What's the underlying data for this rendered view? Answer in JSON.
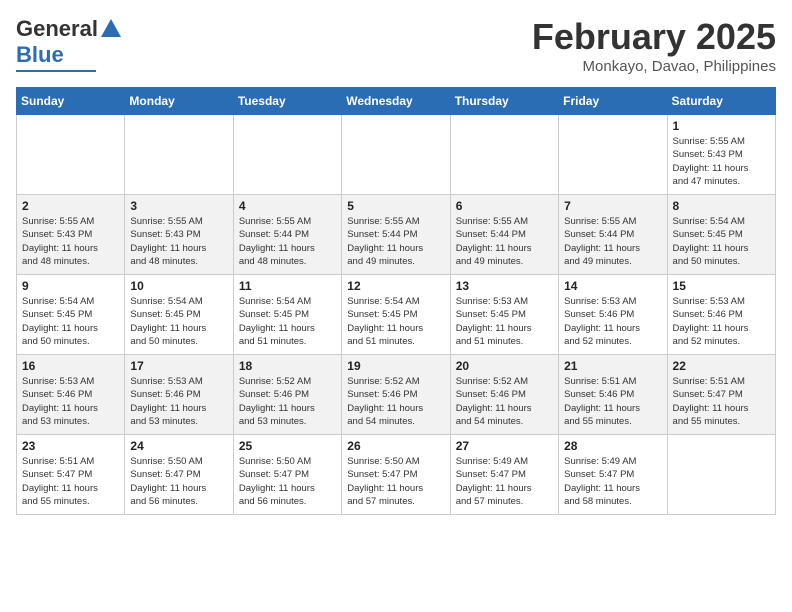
{
  "header": {
    "logo_general": "General",
    "logo_blue": "Blue",
    "month_year": "February 2025",
    "location": "Monkayo, Davao, Philippines"
  },
  "days_of_week": [
    "Sunday",
    "Monday",
    "Tuesday",
    "Wednesday",
    "Thursday",
    "Friday",
    "Saturday"
  ],
  "weeks": [
    [
      {
        "day": "",
        "info": ""
      },
      {
        "day": "",
        "info": ""
      },
      {
        "day": "",
        "info": ""
      },
      {
        "day": "",
        "info": ""
      },
      {
        "day": "",
        "info": ""
      },
      {
        "day": "",
        "info": ""
      },
      {
        "day": "1",
        "info": "Sunrise: 5:55 AM\nSunset: 5:43 PM\nDaylight: 11 hours\nand 47 minutes."
      }
    ],
    [
      {
        "day": "2",
        "info": "Sunrise: 5:55 AM\nSunset: 5:43 PM\nDaylight: 11 hours\nand 48 minutes."
      },
      {
        "day": "3",
        "info": "Sunrise: 5:55 AM\nSunset: 5:43 PM\nDaylight: 11 hours\nand 48 minutes."
      },
      {
        "day": "4",
        "info": "Sunrise: 5:55 AM\nSunset: 5:44 PM\nDaylight: 11 hours\nand 48 minutes."
      },
      {
        "day": "5",
        "info": "Sunrise: 5:55 AM\nSunset: 5:44 PM\nDaylight: 11 hours\nand 49 minutes."
      },
      {
        "day": "6",
        "info": "Sunrise: 5:55 AM\nSunset: 5:44 PM\nDaylight: 11 hours\nand 49 minutes."
      },
      {
        "day": "7",
        "info": "Sunrise: 5:55 AM\nSunset: 5:44 PM\nDaylight: 11 hours\nand 49 minutes."
      },
      {
        "day": "8",
        "info": "Sunrise: 5:54 AM\nSunset: 5:45 PM\nDaylight: 11 hours\nand 50 minutes."
      }
    ],
    [
      {
        "day": "9",
        "info": "Sunrise: 5:54 AM\nSunset: 5:45 PM\nDaylight: 11 hours\nand 50 minutes."
      },
      {
        "day": "10",
        "info": "Sunrise: 5:54 AM\nSunset: 5:45 PM\nDaylight: 11 hours\nand 50 minutes."
      },
      {
        "day": "11",
        "info": "Sunrise: 5:54 AM\nSunset: 5:45 PM\nDaylight: 11 hours\nand 51 minutes."
      },
      {
        "day": "12",
        "info": "Sunrise: 5:54 AM\nSunset: 5:45 PM\nDaylight: 11 hours\nand 51 minutes."
      },
      {
        "day": "13",
        "info": "Sunrise: 5:53 AM\nSunset: 5:45 PM\nDaylight: 11 hours\nand 51 minutes."
      },
      {
        "day": "14",
        "info": "Sunrise: 5:53 AM\nSunset: 5:46 PM\nDaylight: 11 hours\nand 52 minutes."
      },
      {
        "day": "15",
        "info": "Sunrise: 5:53 AM\nSunset: 5:46 PM\nDaylight: 11 hours\nand 52 minutes."
      }
    ],
    [
      {
        "day": "16",
        "info": "Sunrise: 5:53 AM\nSunset: 5:46 PM\nDaylight: 11 hours\nand 53 minutes."
      },
      {
        "day": "17",
        "info": "Sunrise: 5:53 AM\nSunset: 5:46 PM\nDaylight: 11 hours\nand 53 minutes."
      },
      {
        "day": "18",
        "info": "Sunrise: 5:52 AM\nSunset: 5:46 PM\nDaylight: 11 hours\nand 53 minutes."
      },
      {
        "day": "19",
        "info": "Sunrise: 5:52 AM\nSunset: 5:46 PM\nDaylight: 11 hours\nand 54 minutes."
      },
      {
        "day": "20",
        "info": "Sunrise: 5:52 AM\nSunset: 5:46 PM\nDaylight: 11 hours\nand 54 minutes."
      },
      {
        "day": "21",
        "info": "Sunrise: 5:51 AM\nSunset: 5:46 PM\nDaylight: 11 hours\nand 55 minutes."
      },
      {
        "day": "22",
        "info": "Sunrise: 5:51 AM\nSunset: 5:47 PM\nDaylight: 11 hours\nand 55 minutes."
      }
    ],
    [
      {
        "day": "23",
        "info": "Sunrise: 5:51 AM\nSunset: 5:47 PM\nDaylight: 11 hours\nand 55 minutes."
      },
      {
        "day": "24",
        "info": "Sunrise: 5:50 AM\nSunset: 5:47 PM\nDaylight: 11 hours\nand 56 minutes."
      },
      {
        "day": "25",
        "info": "Sunrise: 5:50 AM\nSunset: 5:47 PM\nDaylight: 11 hours\nand 56 minutes."
      },
      {
        "day": "26",
        "info": "Sunrise: 5:50 AM\nSunset: 5:47 PM\nDaylight: 11 hours\nand 57 minutes."
      },
      {
        "day": "27",
        "info": "Sunrise: 5:49 AM\nSunset: 5:47 PM\nDaylight: 11 hours\nand 57 minutes."
      },
      {
        "day": "28",
        "info": "Sunrise: 5:49 AM\nSunset: 5:47 PM\nDaylight: 11 hours\nand 58 minutes."
      },
      {
        "day": "",
        "info": ""
      }
    ]
  ]
}
